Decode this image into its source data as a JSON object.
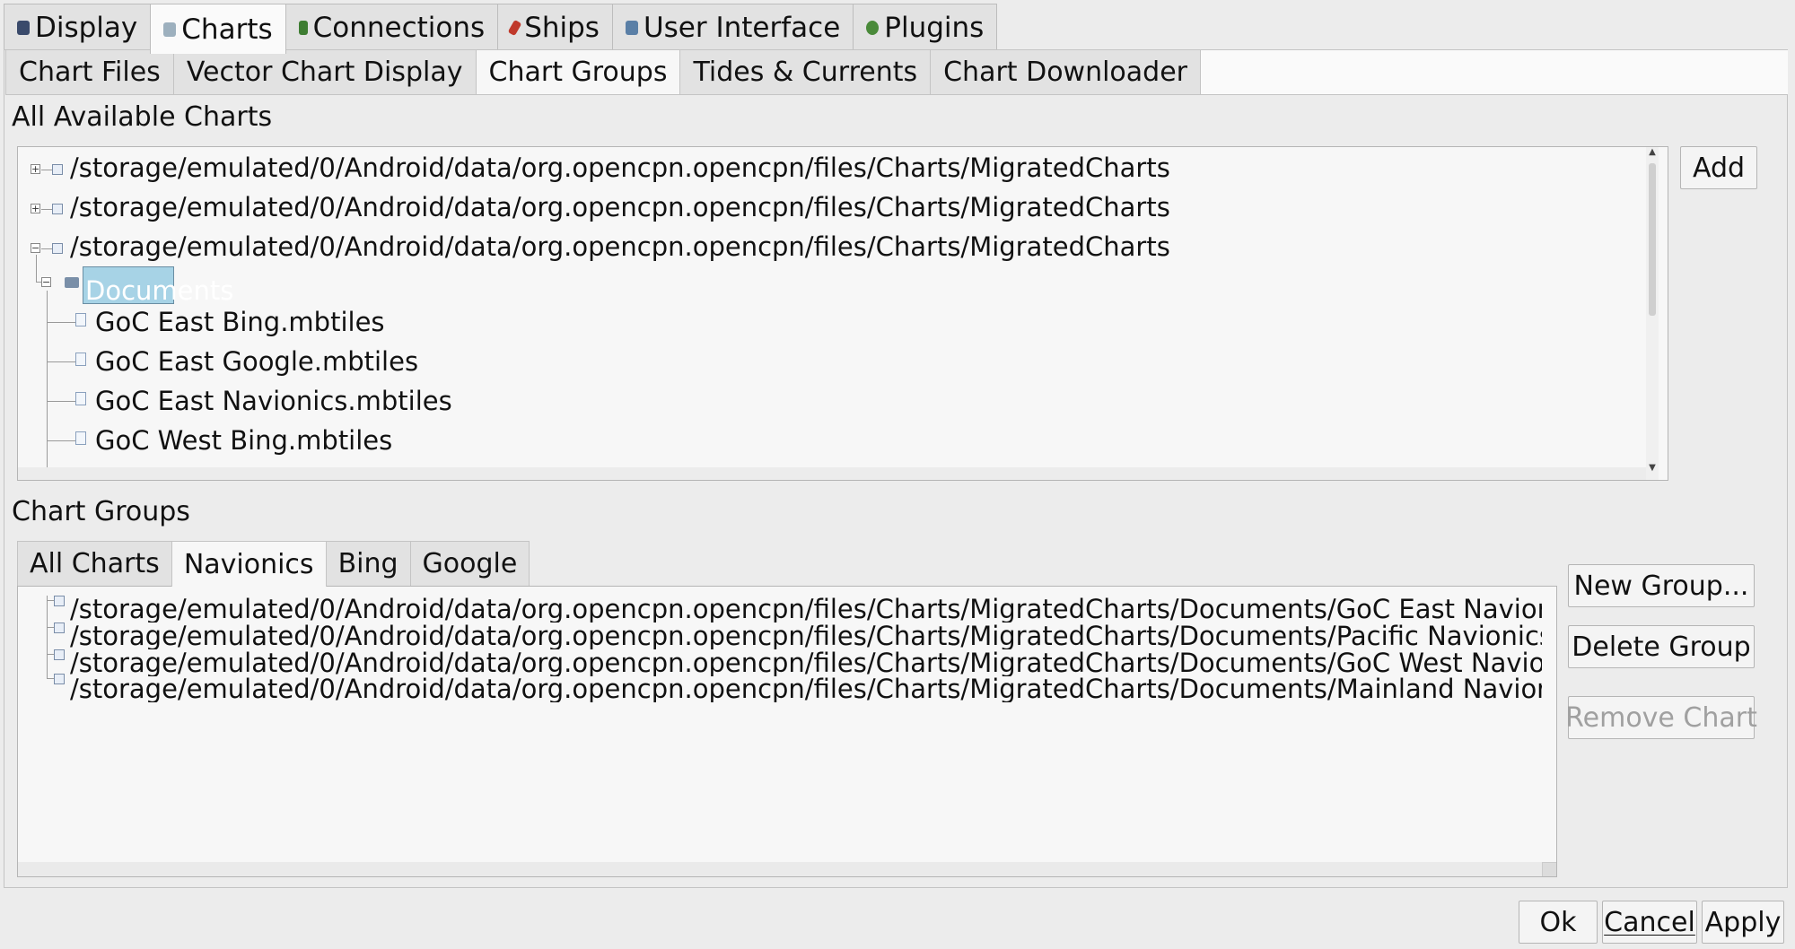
{
  "top_tabs": [
    {
      "label": "Display",
      "icon": "monitor-icon",
      "color": "#3a4a6b"
    },
    {
      "label": "Charts",
      "icon": "chart-icon",
      "color": "#8aa0b0"
    },
    {
      "label": "Connections",
      "icon": "connection-icon",
      "color": "#3e7d32"
    },
    {
      "label": "Ships",
      "icon": "ship-icon",
      "color": "#c0392b"
    },
    {
      "label": "User Interface",
      "icon": "ui-icon",
      "color": "#5a7fa6"
    },
    {
      "label": "Plugins",
      "icon": "plugin-icon",
      "color": "#4a8a3a"
    }
  ],
  "active_top_tab": "Charts",
  "sub_tabs": [
    "Chart Files",
    "Vector Chart Display",
    "Chart Groups",
    "Tides & Currents",
    "Chart Downloader"
  ],
  "active_sub_tab": "Chart Groups",
  "available": {
    "title": "All Available Charts",
    "dirs": [
      "/storage/emulated/0/Android/data/org.opencpn.opencpn/files/Charts/MigratedCharts",
      "/storage/emulated/0/Android/data/org.opencpn.opencpn/files/Charts/MigratedCharts",
      "/storage/emulated/0/Android/data/org.opencpn.opencpn/files/Charts/MigratedCharts"
    ],
    "folder": "Documents",
    "files": [
      "GoC  East  Bing.mbtiles",
      "GoC  East  Google.mbtiles",
      "GoC  East  Navionics.mbtiles",
      "GoC  West  Bing.mbtiles"
    ],
    "add_label": "Add"
  },
  "groups": {
    "title": "Chart Groups",
    "tabs": [
      "All Charts",
      "Navionics",
      "Bing",
      "Google"
    ],
    "active_tab": "Navionics",
    "entries": [
      "/storage/emulated/0/Android/data/org.opencpn.opencpn/files/Charts/MigratedCharts/Documents/GoC  East  Navionics.mbtiles",
      "/storage/emulated/0/Android/data/org.opencpn.opencpn/files/Charts/MigratedCharts/Documents/Pacific  Navionics.mbtiles",
      "/storage/emulated/0/Android/data/org.opencpn.opencpn/files/Charts/MigratedCharts/Documents/GoC  West  Navionics.mbtiles",
      "/storage/emulated/0/Android/data/org.opencpn.opencpn/files/Charts/MigratedCharts/Documents/Mainland  Navionics.mbtiles"
    ],
    "new_group_label": "New Group...",
    "delete_group_label": "Delete Group",
    "remove_chart_label": "Remove Chart"
  },
  "footer": {
    "ok_label": "Ok",
    "cancel_label": "Cancel",
    "apply_label": "Apply"
  }
}
